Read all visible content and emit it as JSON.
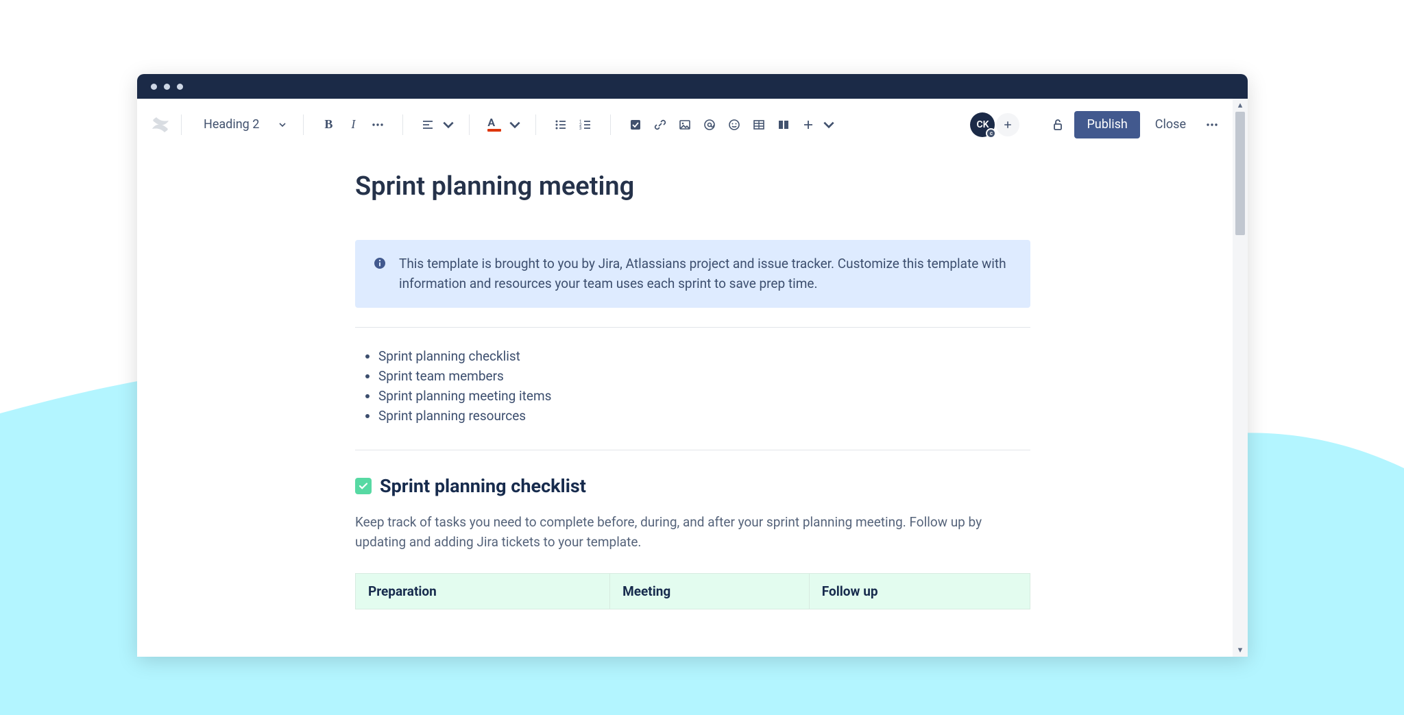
{
  "toolbar": {
    "heading_selector": "Heading 2",
    "avatar_initials": "CK",
    "avatar_sub": "c",
    "publish_label": "Publish",
    "close_label": "Close"
  },
  "page": {
    "title": "Sprint planning meeting",
    "info_panel": "This template is brought to you by Jira, Atlassians project and issue tracker. Customize this template with information and resources your team uses each sprint to save prep time.",
    "toc": [
      "Sprint planning checklist",
      "Sprint team members",
      "Sprint planning meeting items",
      "Sprint planning resources"
    ],
    "section1": {
      "heading": "Sprint planning checklist",
      "description": "Keep track of tasks you need to complete before, during, and after your sprint planning meeting. Follow up by updating and adding Jira tickets to your template.",
      "table_headers": [
        "Preparation",
        "Meeting",
        "Follow up"
      ]
    }
  }
}
